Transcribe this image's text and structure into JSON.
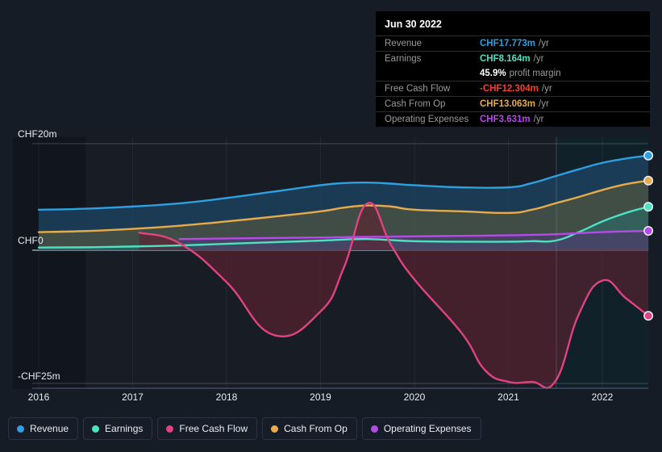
{
  "background": "#151c26",
  "tooltip": {
    "date": "Jun 30 2022",
    "rows": [
      {
        "label": "Revenue",
        "value": "CHF17.773m",
        "unit": "/yr",
        "color": "#2e9fe0"
      },
      {
        "label": "Earnings",
        "value": "CHF8.164m",
        "unit": "/yr",
        "color": "#4ce1c0"
      },
      {
        "label": "",
        "value": "45.9%",
        "unit": "profit margin",
        "color": "#ffffff"
      },
      {
        "label": "Free Cash Flow",
        "value": "-CHF12.304m",
        "unit": "/yr",
        "color": "#ff3b30"
      },
      {
        "label": "Cash From Op",
        "value": "CHF13.063m",
        "unit": "/yr",
        "color": "#e8ab4a"
      },
      {
        "label": "Operating Expenses",
        "value": "CHF3.631m",
        "unit": "/yr",
        "color": "#b54ae8"
      }
    ]
  },
  "legend": {
    "items": [
      {
        "label": "Revenue",
        "color": "#2e9fe0"
      },
      {
        "label": "Earnings",
        "color": "#4ce1c0"
      },
      {
        "label": "Free Cash Flow",
        "color": "#e0437f"
      },
      {
        "label": "Cash From Op",
        "color": "#e8ab4a"
      },
      {
        "label": "Operating Expenses",
        "color": "#b54ae8"
      }
    ]
  },
  "chart_data": {
    "type": "area",
    "title": "",
    "xlabel": "",
    "ylabel": "",
    "currency": "CHF",
    "units": "millions",
    "grid": true,
    "legend_position": "bottom",
    "xlim": [
      2015.72,
      2022.49
    ],
    "ylim": [
      -25,
      20
    ],
    "y_ticks": [
      {
        "value": 20,
        "label": "CHF20m"
      },
      {
        "value": 0,
        "label": "CHF0"
      },
      {
        "value": -25,
        "label": "-CHF25m"
      }
    ],
    "x_ticks": [
      {
        "value": 2016,
        "label": "2016"
      },
      {
        "value": 2017,
        "label": "2017"
      },
      {
        "value": 2018,
        "label": "2018"
      },
      {
        "value": 2019,
        "label": "2019"
      },
      {
        "value": 2020,
        "label": "2020"
      },
      {
        "value": 2021,
        "label": "2021"
      },
      {
        "value": 2022,
        "label": "2022"
      }
    ],
    "forecast_boundary": 2021.51,
    "highlight_band": {
      "start": 2016.5,
      "end": 2021.51
    },
    "series": [
      {
        "name": "Revenue",
        "color": "#2e9fe0",
        "fill": "#1d4362",
        "x": [
          2016.0,
          2016.5,
          2017.0,
          2017.5,
          2018.0,
          2018.5,
          2019.0,
          2019.25,
          2019.5,
          2019.75,
          2020.0,
          2020.5,
          2021.0,
          2021.25,
          2021.5,
          2021.75,
          2022.0,
          2022.25,
          2022.49
        ],
        "values": [
          7.6,
          7.8,
          8.2,
          8.8,
          9.8,
          11.0,
          12.2,
          12.6,
          12.7,
          12.5,
          12.2,
          11.8,
          11.8,
          12.6,
          13.9,
          15.2,
          16.4,
          17.2,
          17.773
        ]
      },
      {
        "name": "Cash From Op",
        "color": "#e8ab4a",
        "fill": "#4a5242",
        "x": [
          2016.0,
          2016.5,
          2017.0,
          2017.5,
          2018.0,
          2018.5,
          2019.0,
          2019.25,
          2019.5,
          2019.75,
          2020.0,
          2020.5,
          2021.0,
          2021.25,
          2021.5,
          2021.75,
          2022.0,
          2022.25,
          2022.49
        ],
        "values": [
          3.4,
          3.6,
          4.0,
          4.6,
          5.4,
          6.3,
          7.3,
          8.0,
          8.4,
          8.2,
          7.6,
          7.3,
          7.0,
          7.6,
          8.8,
          10.0,
          11.3,
          12.4,
          13.063
        ]
      },
      {
        "name": "Earnings",
        "color": "#4ce1c0",
        "fill": "#2f6560",
        "x": [
          2016.0,
          2016.5,
          2017.0,
          2017.5,
          2018.0,
          2018.5,
          2019.0,
          2019.25,
          2019.5,
          2019.75,
          2020.0,
          2020.5,
          2021.0,
          2021.25,
          2021.5,
          2021.75,
          2022.0,
          2022.25,
          2022.49
        ],
        "values": [
          0.5,
          0.55,
          0.7,
          0.9,
          1.2,
          1.5,
          1.8,
          2.0,
          2.1,
          1.9,
          1.7,
          1.6,
          1.6,
          1.7,
          1.8,
          3.4,
          5.4,
          7.0,
          8.164
        ]
      },
      {
        "name": "Operating Expenses",
        "color": "#b54ae8",
        "fill": "#4a4068",
        "x": [
          2017.5,
          2018.0,
          2018.5,
          2019.0,
          2019.5,
          2020.0,
          2020.5,
          2021.0,
          2021.5,
          2022.0,
          2022.49
        ],
        "values": [
          2.1,
          2.2,
          2.3,
          2.4,
          2.5,
          2.6,
          2.7,
          2.8,
          3.0,
          3.4,
          3.631
        ]
      },
      {
        "name": "Free Cash Flow",
        "color": "#e0437f",
        "fill": "#5e2230",
        "x": [
          2017.07,
          2017.5,
          2018.0,
          2018.5,
          2019.0,
          2019.25,
          2019.5,
          2019.75,
          2020.0,
          2020.5,
          2020.75,
          2021.0,
          2021.25,
          2021.5,
          2021.75,
          2022.0,
          2022.25,
          2022.49
        ],
        "values": [
          3.3,
          1.3,
          -6.0,
          -15.9,
          -11.5,
          -3.2,
          8.8,
          1.0,
          -5.5,
          -15.5,
          -22.5,
          -24.7,
          -24.7,
          -24.6,
          -12.0,
          -5.7,
          -9.0,
          -12.304
        ]
      }
    ]
  }
}
